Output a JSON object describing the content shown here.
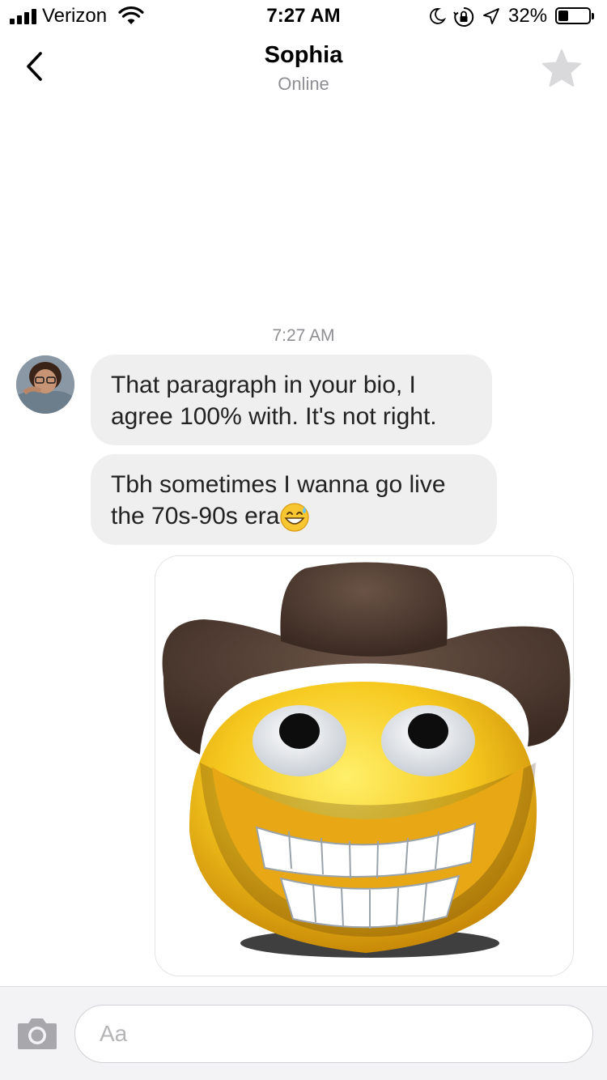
{
  "status_bar": {
    "carrier": "Verizon",
    "time": "7:27 AM",
    "battery_percent": "32%",
    "battery_level": 0.32,
    "icons": [
      "signal-bars-icon",
      "wifi-icon",
      "moon-icon",
      "rotation-lock-icon",
      "location-arrow-icon",
      "battery-icon"
    ]
  },
  "header": {
    "contact_name": "Sophia",
    "presence": "Online",
    "back_icon": "chevron-left-icon",
    "favorite_icon": "star-icon"
  },
  "conversation": {
    "timestamp": "7:27 AM",
    "messages": [
      {
        "sender": "Sophia",
        "text": "That paragraph in your bio, I agree 100% with. It's not right."
      },
      {
        "sender": "Sophia",
        "text": "Tbh sometimes I wanna go live the 70s-90s era",
        "emoji": "grinning-sweat-emoji"
      },
      {
        "sender": "me",
        "type": "sticker",
        "sticker": "cowboy-hat-grinning-face-sticker"
      }
    ]
  },
  "composer": {
    "placeholder": "Aa",
    "value": "",
    "camera_icon": "camera-icon"
  },
  "colors": {
    "bubble": "#efefef",
    "secondary_text": "#8e8e93",
    "composer_bg": "#f3f3f5"
  }
}
